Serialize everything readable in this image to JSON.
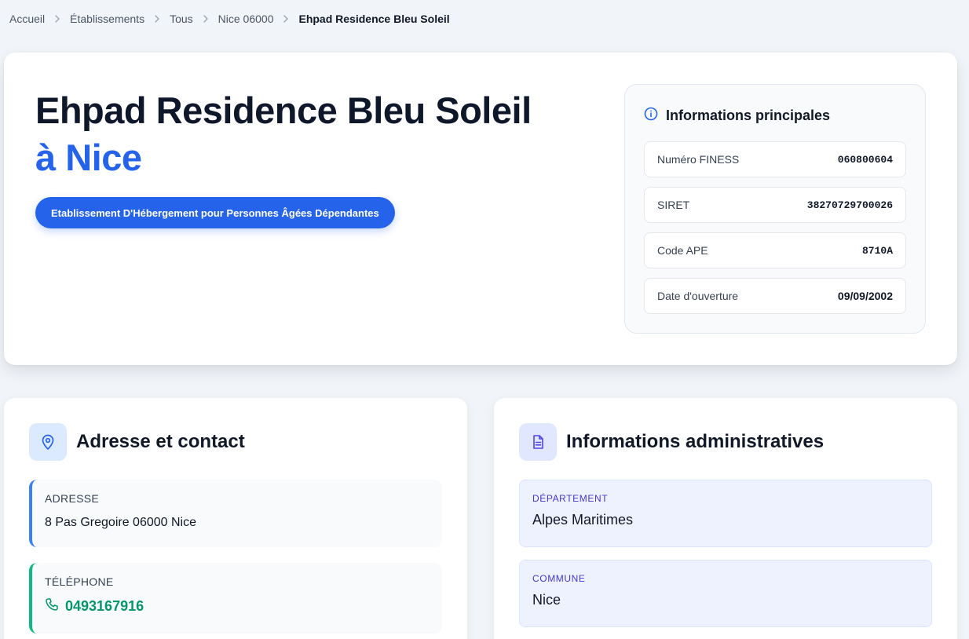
{
  "breadcrumb": {
    "items": [
      "Accueil",
      "Établissements",
      "Tous",
      "Nice 06000"
    ],
    "current": "Ehpad Residence Bleu Soleil"
  },
  "hero": {
    "title_line1": "Ehpad Residence Bleu Soleil",
    "title_line2": "à Nice",
    "type_label": "Etablissement D'Hébergement pour Personnes Âgées Dépendantes"
  },
  "info_panel": {
    "title": "Informations principales",
    "icon": "info-icon",
    "rows": [
      {
        "label": "Numéro FINESS",
        "value": "060800604"
      },
      {
        "label": "SIRET",
        "value": "38270729700026"
      },
      {
        "label": "Code APE",
        "value": "8710A"
      },
      {
        "label": "Date d'ouverture",
        "value": "09/09/2002"
      }
    ]
  },
  "contact_card": {
    "title": "Adresse et contact",
    "icon": "map-pin-icon",
    "address_label": "ADRESSE",
    "address_value": "8 Pas Gregoire 06000 Nice",
    "phone_label": "TÉLÉPHONE",
    "phone_value": "0493167916",
    "phone_icon": "phone-icon"
  },
  "admin_card": {
    "title": "Informations administratives",
    "icon": "document-icon",
    "department_label": "DÉPARTEMENT",
    "department_value": "Alpes Maritimes",
    "commune_label": "COMMUNE",
    "commune_value": "Nice"
  },
  "colors": {
    "accent_blue": "#2563eb",
    "phone_green": "#059669",
    "admin_label_indigo": "#4338ca",
    "background": "#f1f5f9"
  }
}
